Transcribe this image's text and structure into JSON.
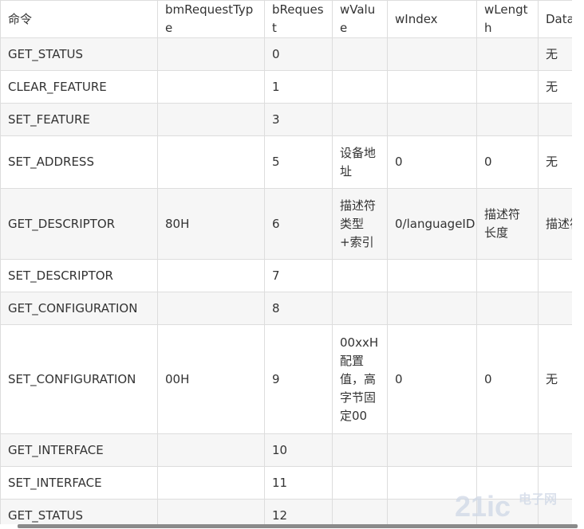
{
  "headers": [
    "命令",
    "bmRequestType",
    "bRequest",
    "wValue",
    "wIndex",
    "wLength",
    "Data"
  ],
  "rows": [
    [
      "GET_STATUS",
      "",
      "0",
      "",
      "",
      "",
      "无"
    ],
    [
      "CLEAR_FEATURE",
      "",
      "1",
      "",
      "",
      "",
      "无"
    ],
    [
      "SET_FEATURE",
      "",
      "3",
      "",
      "",
      "",
      ""
    ],
    [
      "SET_ADDRESS",
      "",
      "5",
      "设备地址",
      "0",
      "0",
      "无"
    ],
    [
      "GET_DESCRIPTOR",
      "80H",
      "6",
      "描述符类型+索引",
      "0/languageID",
      "描述符长度",
      "描述符"
    ],
    [
      "SET_DESCRIPTOR",
      "",
      "7",
      "",
      "",
      "",
      ""
    ],
    [
      "GET_CONFIGURATION",
      "",
      "8",
      "",
      "",
      "",
      ""
    ],
    [
      "SET_CONFIGURATION",
      "00H",
      "9",
      "00xxH配置值，高字节固定00",
      "0",
      "0",
      "无"
    ],
    [
      "GET_INTERFACE",
      "",
      "10",
      "",
      "",
      "",
      ""
    ],
    [
      "SET_INTERFACE",
      "",
      "11",
      "",
      "",
      "",
      ""
    ],
    [
      "GET_STATUS",
      "",
      "12",
      "",
      "",
      "",
      ""
    ]
  ],
  "watermark": {
    "logo": "21ic",
    "text": "电子网"
  }
}
